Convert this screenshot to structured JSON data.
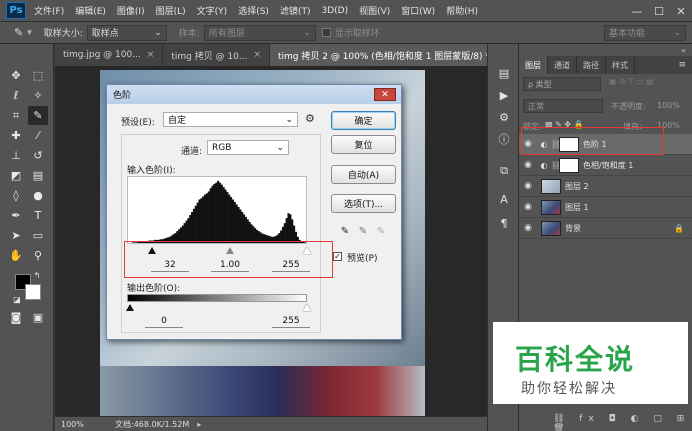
{
  "app": {
    "logo": "Ps"
  },
  "menu": [
    "文件(F)",
    "编辑(E)",
    "图像(I)",
    "图层(L)",
    "文字(Y)",
    "选择(S)",
    "滤镜(T)",
    "3D(D)",
    "视图(V)",
    "窗口(W)",
    "帮助(H)"
  ],
  "window_controls": {
    "minimize": "—",
    "restore": "☐",
    "close": "✕"
  },
  "options": {
    "sample_size_label": "取样大小:",
    "sample_size_value": "取样点",
    "sample_label": "样本:",
    "sample_value": "所有图层",
    "show_ring_label": "显示取样环",
    "workspace": "基本功能"
  },
  "tabs": [
    {
      "label": "timg.jpg @ 100...",
      "close": "×"
    },
    {
      "label": "timg 拷贝 @ 10...",
      "close": "×"
    },
    {
      "label": "timg 拷贝 2 @ 100% (色相/饱和度 1 图层蒙版/8) *",
      "close": "×"
    }
  ],
  "status": {
    "zoom": "100%",
    "doc_info": "文档:468.0K/1.52M"
  },
  "dialog": {
    "title": "色阶",
    "close": "✕",
    "preset_label": "预设(E):",
    "preset_value": "自定",
    "channel_label": "通道:",
    "channel_value": "RGB",
    "input_levels_label": "输入色阶(I):",
    "input_black": "32",
    "input_gamma": "1.00",
    "input_white": "255",
    "output_levels_label": "输出色阶(O):",
    "output_black": "0",
    "output_white": "255",
    "buttons": {
      "ok": "确定",
      "reset": "复位",
      "auto": "自动(A)",
      "options": "选项(T)..."
    },
    "preview_label": "预览(P)",
    "preview_checked": true
  },
  "histogram": [
    0,
    0,
    1,
    1,
    1,
    2,
    2,
    2,
    3,
    3,
    3,
    4,
    4,
    4,
    5,
    5,
    5,
    6,
    6,
    7,
    8,
    9,
    10,
    12,
    14,
    16,
    19,
    22,
    25,
    28,
    32,
    36,
    40,
    45,
    50,
    55,
    60,
    65,
    70,
    72,
    75,
    78,
    80,
    83,
    88,
    92,
    95,
    97,
    100,
    97,
    94,
    90,
    86,
    82,
    78,
    74,
    70,
    66,
    62,
    58,
    54,
    50,
    46,
    42,
    38,
    34,
    30,
    27,
    24,
    21,
    19,
    17,
    15,
    14,
    13,
    12,
    11,
    10,
    10,
    11,
    13,
    16,
    20,
    26,
    32,
    40,
    48,
    46,
    38,
    28,
    18,
    10,
    5,
    3,
    2,
    1
  ],
  "layers_panel": {
    "tabs": [
      "图层",
      "通道",
      "路径",
      "样式"
    ],
    "kind_filter": "ρ 类型",
    "blend_mode": "正常",
    "opacity_label": "不透明度:",
    "opacity_value": "100%",
    "lock_label": "锁定:",
    "fill_label": "填充:",
    "fill_value": "100%",
    "layers": [
      {
        "name": "色阶 1",
        "selected": true,
        "lock": ""
      },
      {
        "name": "色相/饱和度 1",
        "selected": false,
        "lock": ""
      },
      {
        "name": "图层 2",
        "selected": false,
        "lock": ""
      },
      {
        "name": "图层 1",
        "selected": false,
        "lock": ""
      },
      {
        "name": "背景",
        "selected": false,
        "lock": "🔒"
      }
    ]
  },
  "watermark": {
    "main": "百科全说",
    "sub": "助你轻松解决"
  },
  "colors": {
    "selection_highlight": "#e03a3a",
    "watermark_green": "#2aa44a"
  }
}
